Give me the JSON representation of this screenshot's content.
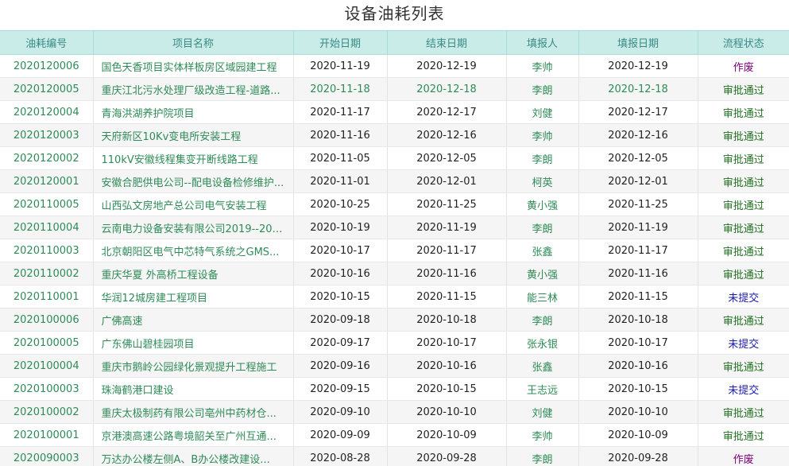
{
  "page_title": "设备油耗列表",
  "columns": [
    "油耗编号",
    "项目名称",
    "开始日期",
    "结束日期",
    "填报人",
    "填报日期",
    "流程状态"
  ],
  "status_colors": {
    "作废": "#800080",
    "审批通过": "#1f6f1f",
    "未提交": "#1a1aa8"
  },
  "rows": [
    {
      "id": "2020120006",
      "name": "国色天香项目实体样板房区域园建工程",
      "start": "2020-11-19",
      "end": "2020-12-19",
      "person": "李帅",
      "report_date": "2020-12-19",
      "status": "作废"
    },
    {
      "id": "2020120005",
      "name": "重庆江北污水处理厂级改造工程-道路...",
      "start": "2020-11-18",
      "end": "2020-12-18",
      "person": "李朗",
      "report_date": "2020-12-18",
      "status": "审批通过"
    },
    {
      "id": "2020120004",
      "name": "青海洪湖养护院项目",
      "start": "2020-11-17",
      "end": "2020-12-17",
      "person": "刘健",
      "report_date": "2020-12-17",
      "status": "审批通过"
    },
    {
      "id": "2020120003",
      "name": "天府新区10Kv变电所安装工程",
      "start": "2020-11-16",
      "end": "2020-12-16",
      "person": "李帅",
      "report_date": "2020-12-16",
      "status": "审批通过"
    },
    {
      "id": "2020120002",
      "name": "110kV安徽线程集变开断线路工程",
      "start": "2020-11-05",
      "end": "2020-12-05",
      "person": "李朗",
      "report_date": "2020-12-05",
      "status": "审批通过"
    },
    {
      "id": "2020120001",
      "name": "安徽合肥供电公司--配电设备检修维护...",
      "start": "2020-11-01",
      "end": "2020-12-01",
      "person": "柯英",
      "report_date": "2020-12-01",
      "status": "审批通过"
    },
    {
      "id": "2020110005",
      "name": "山西弘文房地产总公司电气安装工程",
      "start": "2020-10-25",
      "end": "2020-11-25",
      "person": "黄小强",
      "report_date": "2020-11-25",
      "status": "审批通过"
    },
    {
      "id": "2020110004",
      "name": "云南电力设备安装有限公司2019--202...",
      "start": "2020-10-19",
      "end": "2020-11-19",
      "person": "李朗",
      "report_date": "2020-11-19",
      "status": "审批通过"
    },
    {
      "id": "2020110003",
      "name": "北京朝阳区电气中芯特气系统之GMS...",
      "start": "2020-10-17",
      "end": "2020-11-17",
      "person": "张鑫",
      "report_date": "2020-11-17",
      "status": "审批通过"
    },
    {
      "id": "2020110002",
      "name": "重庆华夏 外高桥工程设备",
      "start": "2020-10-16",
      "end": "2020-11-16",
      "person": "黄小强",
      "report_date": "2020-11-16",
      "status": "审批通过"
    },
    {
      "id": "2020110001",
      "name": "华润12城房建工程项目",
      "start": "2020-10-15",
      "end": "2020-11-15",
      "person": "能三林",
      "report_date": "2020-11-15",
      "status": "未提交"
    },
    {
      "id": "2020100006",
      "name": "广佛高速",
      "start": "2020-09-18",
      "end": "2020-10-18",
      "person": "李朗",
      "report_date": "2020-10-18",
      "status": "审批通过"
    },
    {
      "id": "2020100005",
      "name": "广东佛山碧桂园项目",
      "start": "2020-09-17",
      "end": "2020-10-17",
      "person": "张永银",
      "report_date": "2020-10-17",
      "status": "未提交"
    },
    {
      "id": "2020100004",
      "name": "重庆市鹅岭公园绿化景观提升工程施工",
      "start": "2020-09-16",
      "end": "2020-10-16",
      "person": "张鑫",
      "report_date": "2020-10-16",
      "status": "审批通过"
    },
    {
      "id": "2020100003",
      "name": "珠海鹤港口建设",
      "start": "2020-09-15",
      "end": "2020-10-15",
      "person": "王志远",
      "report_date": "2020-10-15",
      "status": "未提交"
    },
    {
      "id": "2020100002",
      "name": "重庆太极制药有限公司亳州中药材仓...",
      "start": "2020-09-10",
      "end": "2020-10-10",
      "person": "刘健",
      "report_date": "2020-10-10",
      "status": "审批通过"
    },
    {
      "id": "2020100001",
      "name": "京港澳高速公路粤境韶关至广州互通...",
      "start": "2020-09-09",
      "end": "2020-10-09",
      "person": "李帅",
      "report_date": "2020-10-09",
      "status": "审批通过"
    },
    {
      "id": "2020090003",
      "name": "万达办公楼左侧A、B办公楼改建设...",
      "start": "2020-08-28",
      "end": "2020-09-28",
      "person": "李朗",
      "report_date": "2020-09-28",
      "status": "作废"
    }
  ]
}
